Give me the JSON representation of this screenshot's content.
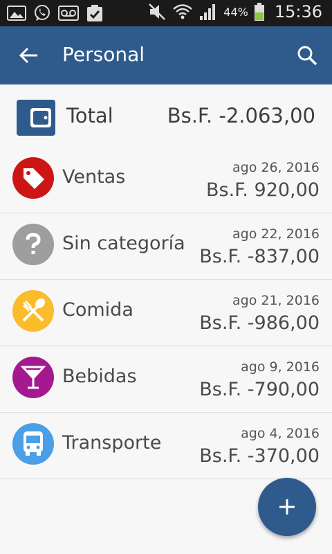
{
  "status_bar": {
    "battery_percent": "44%",
    "time": "15:36",
    "icons": [
      "gallery-icon",
      "whatsapp-icon",
      "voicemail-icon",
      "clipboard-icon",
      "mute-icon",
      "wifi-icon",
      "signal-icon",
      "battery-icon"
    ]
  },
  "app_bar": {
    "title": "Personal",
    "back_icon": "arrow-back-icon",
    "search_icon": "search-icon",
    "color": "#2f5a8c"
  },
  "total": {
    "label": "Total",
    "amount": "Bs.F. -2.063,00",
    "icon": "wallet-icon"
  },
  "categories": [
    {
      "name": "Ventas",
      "date": "ago 26, 2016",
      "amount": "Bs.F. 920,00",
      "icon": "tag-icon",
      "color": "#cc1616"
    },
    {
      "name": "Sin categoría",
      "date": "ago 22, 2016",
      "amount": "Bs.F. -837,00",
      "icon": "question-icon",
      "color": "#9e9e9e"
    },
    {
      "name": "Comida",
      "date": "ago 21, 2016",
      "amount": "Bs.F. -986,00",
      "icon": "fork-spoon-icon",
      "color": "#fbbc2c"
    },
    {
      "name": "Bebidas",
      "date": "ago 9, 2016",
      "amount": "Bs.F. -790,00",
      "icon": "cocktail-icon",
      "color": "#a4198f"
    },
    {
      "name": "Transporte",
      "date": "ago 4, 2016",
      "amount": "Bs.F. -370,00",
      "icon": "bus-icon",
      "color": "#4a9fe6"
    }
  ],
  "fab": {
    "icon": "plus-icon",
    "color": "#2f5a8c"
  }
}
